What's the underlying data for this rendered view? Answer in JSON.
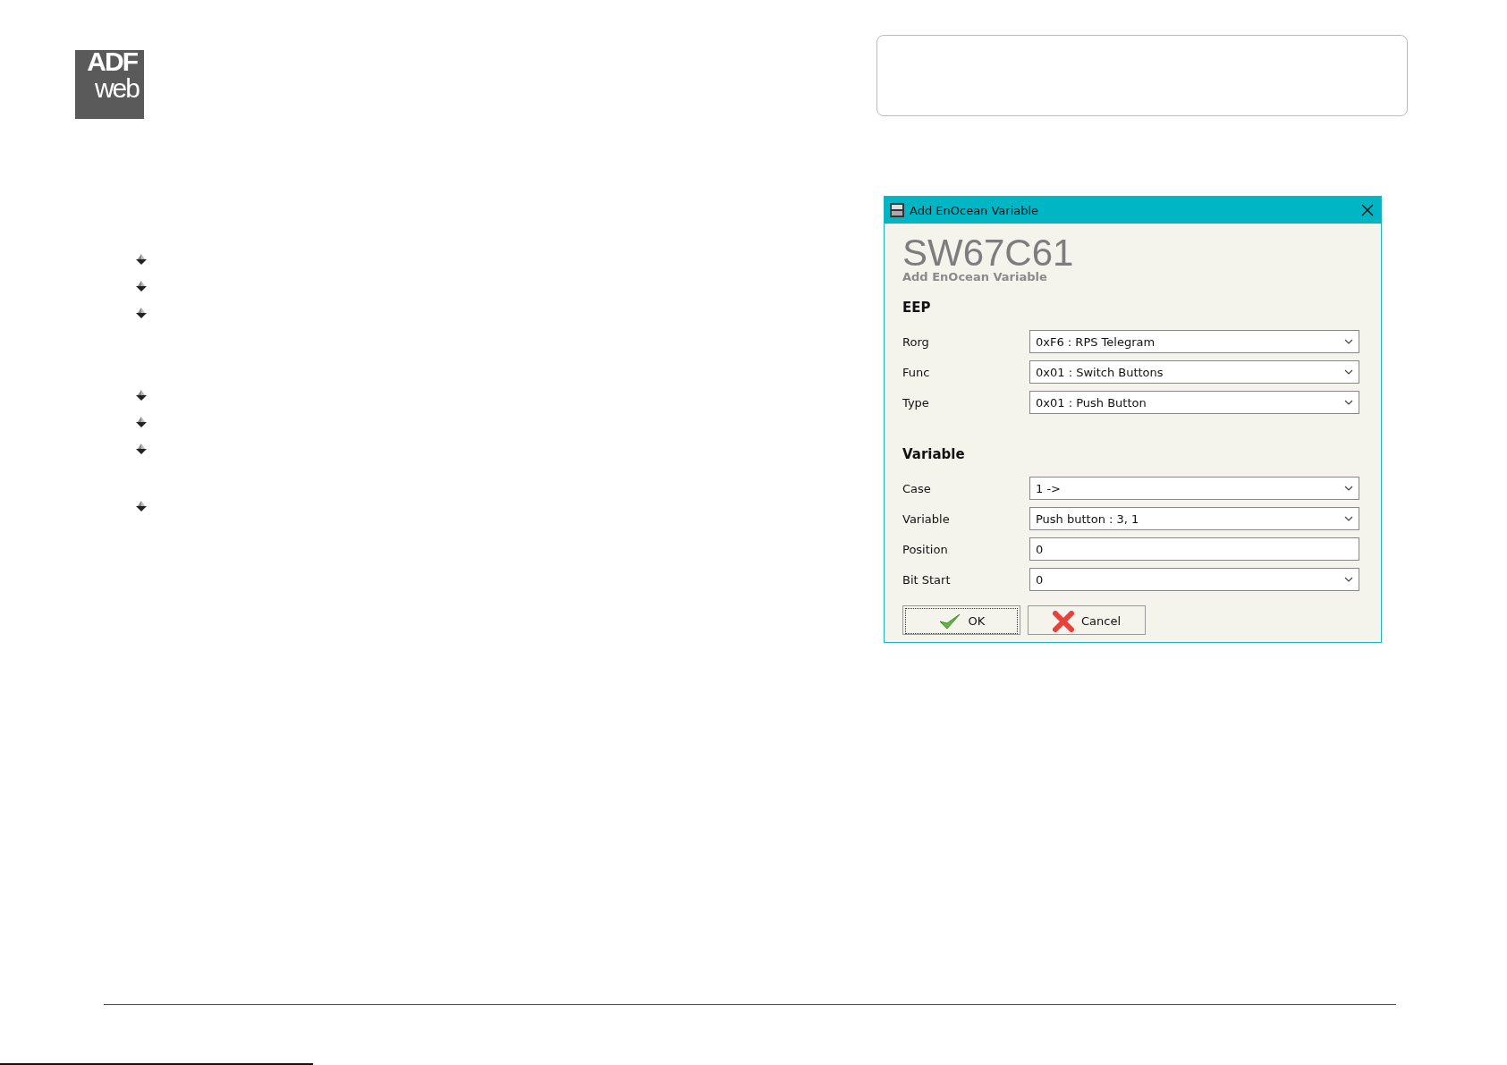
{
  "logo": {
    "top": "ADF",
    "bottom": "web"
  },
  "dialog": {
    "title": "Add EnOcean Variable",
    "heading": "SW67C61",
    "subheading": "Add EnOcean Variable",
    "sections": [
      {
        "title": "EEP",
        "fields": [
          {
            "label": "Rorg",
            "kind": "dropdown",
            "value": "0xF6 : RPS Telegram"
          },
          {
            "label": "Func",
            "kind": "dropdown",
            "value": "0x01 : Switch Buttons"
          },
          {
            "label": "Type",
            "kind": "dropdown",
            "value": "0x01 : Push Button"
          }
        ]
      },
      {
        "title": "Variable",
        "fields": [
          {
            "label": "Case",
            "kind": "dropdown",
            "value": "1 ->"
          },
          {
            "label": "Variable",
            "kind": "dropdown",
            "value": "Push button : 3, 1"
          },
          {
            "label": "Position",
            "kind": "text",
            "value": "0"
          },
          {
            "label": "Bit Start",
            "kind": "dropdown",
            "value": "0"
          }
        ]
      }
    ],
    "buttons": [
      {
        "label": "OK",
        "kind": "ok",
        "focused": true
      },
      {
        "label": "Cancel",
        "kind": "cancel",
        "focused": false
      }
    ]
  }
}
